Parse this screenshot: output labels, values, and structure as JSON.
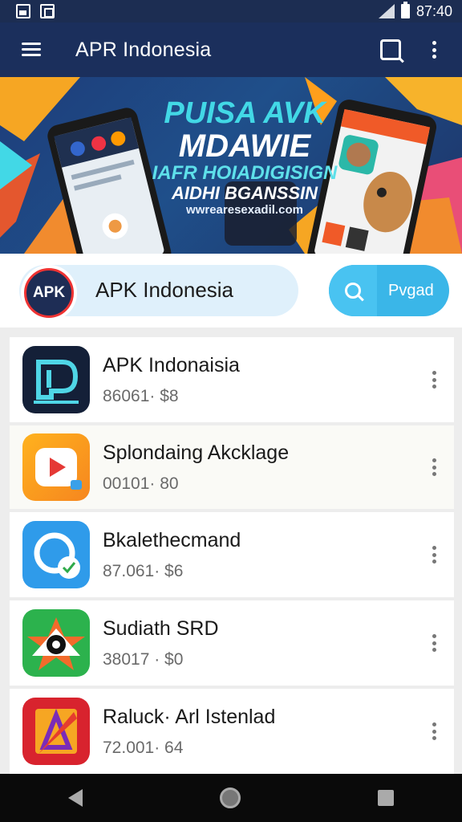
{
  "status_bar": {
    "time": "87:40"
  },
  "app_bar": {
    "title": "APR Indonesia"
  },
  "banner": {
    "line1": "PUISA AVK",
    "line2": "MDAWIE",
    "line3": "IAFR HOIADIGISIGN",
    "line4": "AIDHI BGANSSIN",
    "line5": "wwrearesexadil.com"
  },
  "search": {
    "logo_text": "APK",
    "value": "APK Indonesia",
    "button_label": "Pvgad"
  },
  "apps": [
    {
      "name": "APK Indonaisia",
      "meta": "86061· $8"
    },
    {
      "name": "Splondaing Akcklage",
      "meta": "00101· 80"
    },
    {
      "name": "Bkalethecmand",
      "meta": "87.061· $6"
    },
    {
      "name": "Sudiath SRD",
      "meta": "38017 · $0"
    },
    {
      "name": "Raluck· Arl Istenlad",
      "meta": "72.001· 64"
    }
  ],
  "colors": {
    "app_bar": "#1b2f5c",
    "accent": "#3ab6e8"
  }
}
